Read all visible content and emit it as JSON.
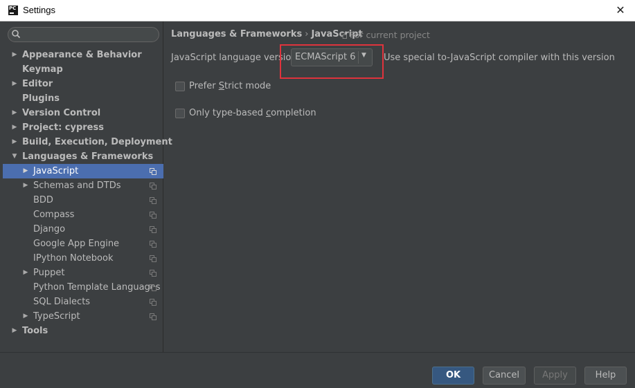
{
  "window": {
    "title": "Settings",
    "app_icon_text": "PC"
  },
  "sidebar": {
    "search": {
      "placeholder": ""
    },
    "items": [
      {
        "label": "Appearance & Behavior",
        "arrow": "▶"
      },
      {
        "label": "Keymap",
        "arrow": ""
      },
      {
        "label": "Editor",
        "arrow": "▶"
      },
      {
        "label": "Plugins",
        "arrow": ""
      },
      {
        "label": "Version Control",
        "arrow": "▶"
      },
      {
        "label": "Project: cypress",
        "arrow": "▶"
      },
      {
        "label": "Build, Execution, Deployment",
        "arrow": "▶"
      },
      {
        "label": "Languages & Frameworks",
        "arrow": "▼"
      },
      {
        "label": "JavaScript",
        "arrow": "▶"
      },
      {
        "label": "Schemas and DTDs",
        "arrow": "▶"
      },
      {
        "label": "BDD",
        "arrow": ""
      },
      {
        "label": "Compass",
        "arrow": ""
      },
      {
        "label": "Django",
        "arrow": ""
      },
      {
        "label": "Google App Engine",
        "arrow": ""
      },
      {
        "label": "IPython Notebook",
        "arrow": ""
      },
      {
        "label": "Puppet",
        "arrow": "▶"
      },
      {
        "label": "Python Template Languages",
        "arrow": ""
      },
      {
        "label": "SQL Dialects",
        "arrow": ""
      },
      {
        "label": "TypeScript",
        "arrow": "▶"
      },
      {
        "label": "Tools",
        "arrow": "▶"
      }
    ]
  },
  "main": {
    "breadcrumb": {
      "parent": "Languages & Frameworks",
      "separator": "›",
      "current": "JavaScript"
    },
    "scope": "For current project",
    "language_version": {
      "label": "JavaScript language version",
      "selected": "ECMAScript 6",
      "hint": "Use special to-JavaScript compiler with this version"
    },
    "prefer_strict": {
      "pre": "Prefer ",
      "mnemonic": "S",
      "post": "trict mode",
      "checked": false
    },
    "type_based": {
      "pre": "Only type-based ",
      "mnemonic": "c",
      "post": "ompletion",
      "checked": false
    }
  },
  "buttons": {
    "ok": "OK",
    "cancel": "Cancel",
    "apply": "Apply",
    "help": "Help"
  },
  "colors": {
    "selection": "#4b6eaf",
    "highlight": "#e0333c",
    "background": "#3c3f41"
  }
}
